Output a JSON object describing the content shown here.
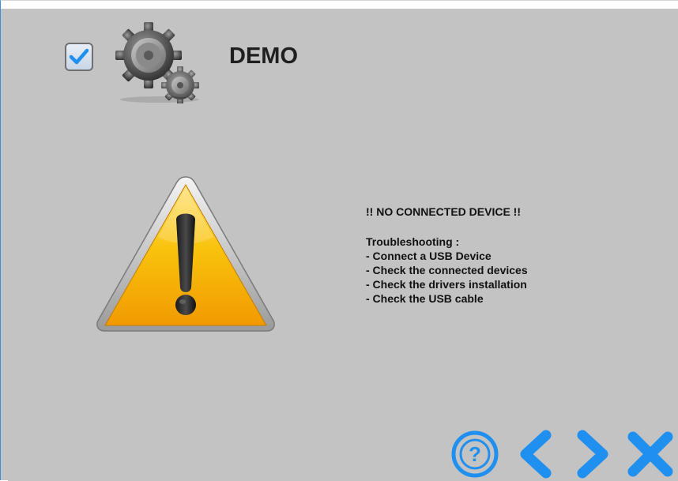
{
  "header": {
    "title": "DEMO",
    "checkbox_checked": true
  },
  "message": {
    "heading": "!! NO CONNECTED DEVICE !!",
    "troubleshooting_title": "Troubleshooting :",
    "items": [
      "- Connect a USB Device",
      "- Check the connected devices",
      "- Check the drivers installation",
      "- Check the USB cable"
    ]
  },
  "nav": {
    "icons": [
      "help-icon",
      "back-icon",
      "next-icon",
      "close-icon"
    ]
  },
  "colors": {
    "background": "#c3c3c3",
    "accent_blue": "#1f8ff0",
    "warning_yellow": "#f7b400",
    "text": "#111111"
  }
}
